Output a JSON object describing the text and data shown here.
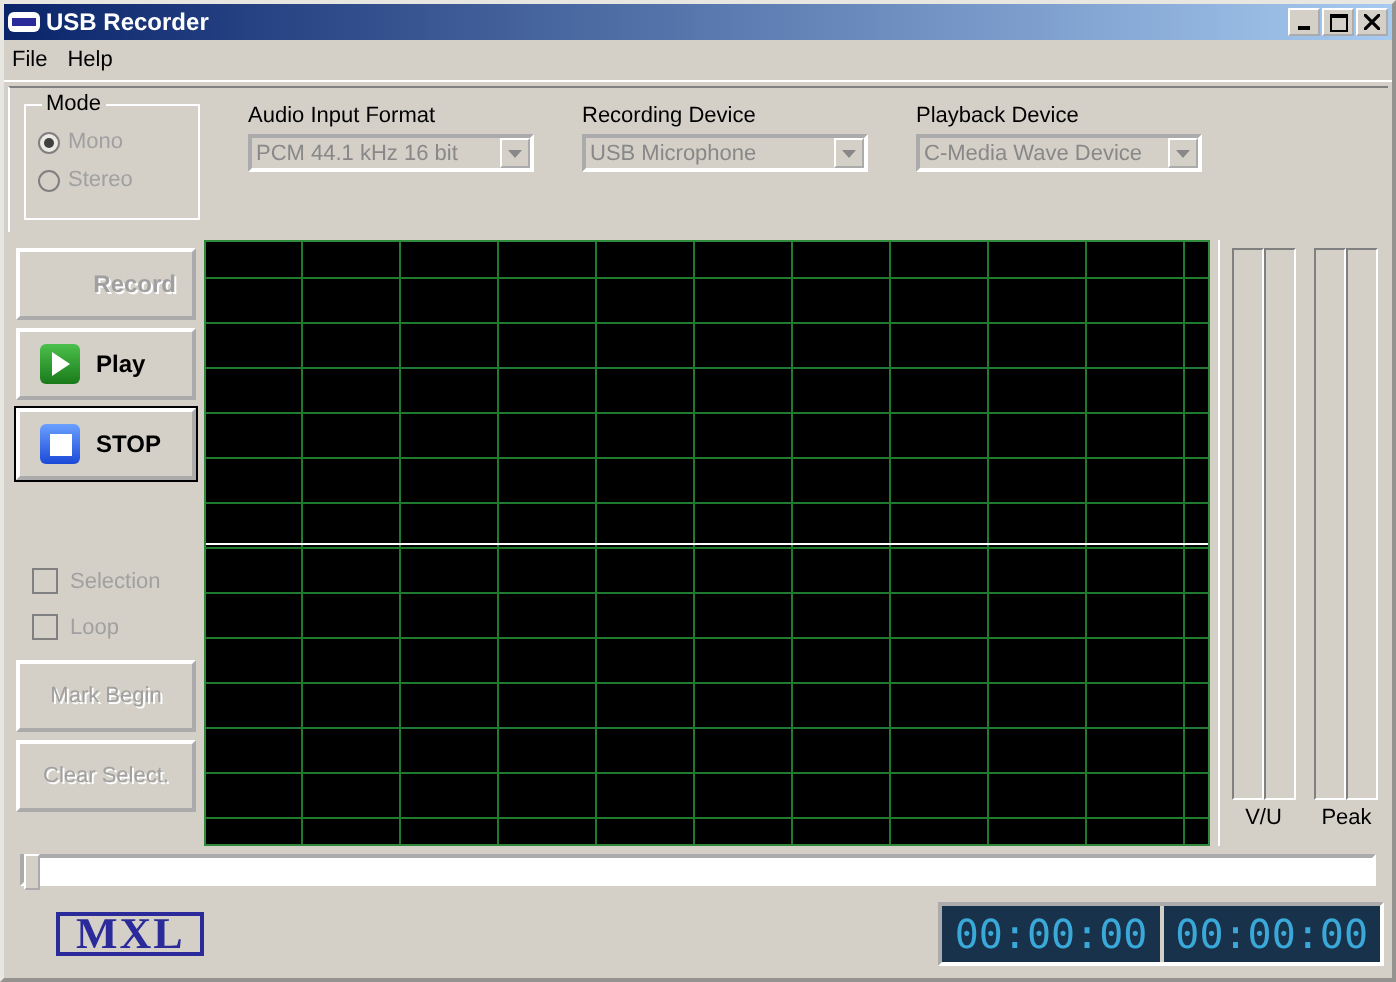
{
  "window": {
    "title": "USB Recorder"
  },
  "menu": [
    {
      "label": "File"
    },
    {
      "label": "Help"
    }
  ],
  "mode": {
    "title": "Mode",
    "options": [
      {
        "label": "Mono",
        "selected": true,
        "disabled": true
      },
      {
        "label": "Stereo",
        "selected": false,
        "disabled": true
      }
    ]
  },
  "dropdowns": [
    {
      "label": "Audio Input Format",
      "value": "PCM 44.1 kHz 16 bit",
      "disabled": true
    },
    {
      "label": "Recording Device",
      "value": "USB Microphone",
      "disabled": true
    },
    {
      "label": "Playback Device",
      "value": "C-Media Wave Device",
      "disabled": true
    }
  ],
  "transport": [
    {
      "label": "Record",
      "kind": "record",
      "disabled": true,
      "focused": false
    },
    {
      "label": "Play",
      "kind": "play",
      "disabled": false,
      "focused": false
    },
    {
      "label": "STOP",
      "kind": "stop",
      "disabled": false,
      "focused": true
    }
  ],
  "checkboxes": [
    {
      "label": "Selection",
      "checked": false,
      "disabled": true
    },
    {
      "label": "Loop",
      "checked": false,
      "disabled": true
    }
  ],
  "edit_buttons": [
    {
      "label": "Mark Begin",
      "disabled": true
    },
    {
      "label": "Clear Select.",
      "disabled": true
    }
  ],
  "meters": [
    {
      "label": "V/U",
      "channels": [
        {
          "level": 0
        },
        {
          "level": 0
        }
      ]
    },
    {
      "label": "Peak",
      "channels": [
        {
          "level": 0
        },
        {
          "level": 0
        }
      ]
    }
  ],
  "position": {
    "level": 0
  },
  "logo": "MXL",
  "time_displays": [
    "00:00:00",
    "00:00:00"
  ]
}
